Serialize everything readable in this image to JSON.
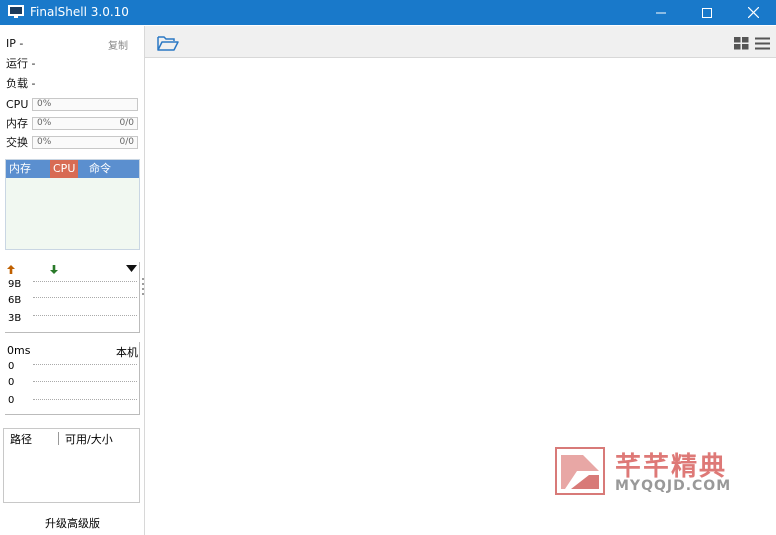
{
  "window": {
    "title": "FinalShell 3.0.10"
  },
  "info": {
    "ip_label": "IP",
    "ip_value": "-",
    "copy_label": "复制",
    "run_label": "运行",
    "run_value": "-",
    "load_label": "负载",
    "load_value": "-"
  },
  "meters": {
    "cpu": {
      "label": "CPU",
      "percent": "0%"
    },
    "mem": {
      "label": "内存",
      "percent": "0%",
      "fraction": "0/0"
    },
    "swap": {
      "label": "交换",
      "percent": "0%",
      "fraction": "0/0"
    }
  },
  "process_tabs": [
    {
      "label": "内存",
      "active": false
    },
    {
      "label": "CPU",
      "active": true
    },
    {
      "label": "命令",
      "active": false
    }
  ],
  "network": {
    "ticks": [
      "9B",
      "6B",
      "3B"
    ]
  },
  "ping": {
    "latency": "0ms",
    "host": "本机",
    "ticks": [
      "0",
      "0",
      "0"
    ]
  },
  "disk": {
    "col_path": "路径",
    "col_size": "可用/大小"
  },
  "upgrade_label": "升级高级版",
  "watermark": {
    "text": "芊芊精典",
    "url": "MYQQJD.COM"
  },
  "colors": {
    "titlebar": "#1979ca",
    "tab_header": "#5b8fcf",
    "tab_active": "#d86b54",
    "upload_arrow": "#c06000",
    "download_arrow": "#2a7a2a"
  }
}
